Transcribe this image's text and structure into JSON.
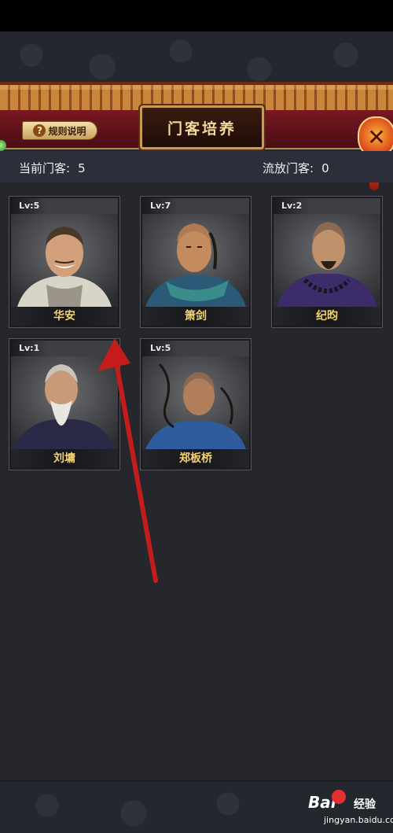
{
  "header": {
    "title": "门客培养",
    "rules_label": "规则说明",
    "rules_icon": "question-icon",
    "close_icon": "close-icon"
  },
  "stats": {
    "current_label": "当前门客:",
    "current_value": "5",
    "exiled_label": "流放门客:",
    "exiled_value": "0"
  },
  "cards": [
    {
      "level": "Lv:5",
      "name": "华安"
    },
    {
      "level": "Lv:7",
      "name": "箫剑"
    },
    {
      "level": "Lv:2",
      "name": "纪昀"
    },
    {
      "level": "Lv:1",
      "name": "刘墉"
    },
    {
      "level": "Lv:5",
      "name": "郑板桥"
    }
  ],
  "watermark": {
    "logo": "Bai",
    "jingyan": "经验",
    "url": "jingyan.baidu.com"
  },
  "colors": {
    "name_gold": "#f3d46c",
    "arrow_red": "#c41c1c",
    "title_gold": "#f3d9a0"
  }
}
